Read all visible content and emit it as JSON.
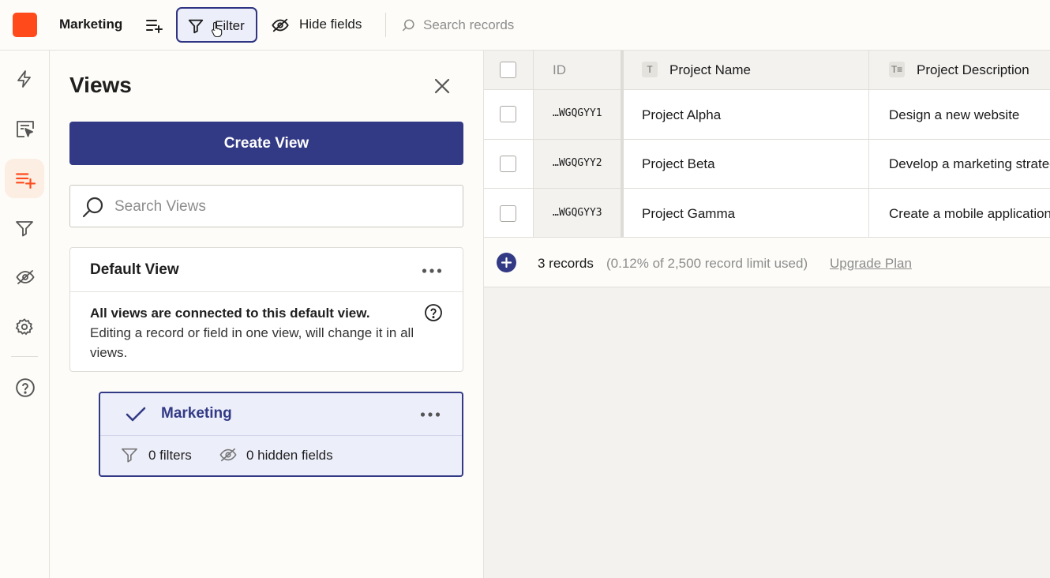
{
  "topbar": {
    "base_name": "Marketing",
    "filter_label": "Filter",
    "hide_fields_label": "Hide fields",
    "search_placeholder": "Search records"
  },
  "views_panel": {
    "title": "Views",
    "create_label": "Create View",
    "search_placeholder": "Search Views",
    "default_view": {
      "name": "Default View",
      "info_bold": "All views are connected to this default view.",
      "info_text": "Editing a record or field in one view, will change it in all views."
    },
    "selected_view": {
      "name": "Marketing",
      "filters_label": "0 filters",
      "hidden_fields_label": "0 hidden fields"
    }
  },
  "grid": {
    "columns": [
      {
        "label": "ID"
      },
      {
        "label": "Project Name",
        "type_icon": "T"
      },
      {
        "label": "Project Description",
        "type_icon": "T≡"
      }
    ],
    "rows": [
      {
        "id": "…WGQGYY1",
        "name": "Project Alpha",
        "description": "Design a new website"
      },
      {
        "id": "…WGQGYY2",
        "name": "Project Beta",
        "description": "Develop a marketing strategy"
      },
      {
        "id": "…WGQGYY3",
        "name": "Project Gamma",
        "description": "Create a mobile application"
      }
    ],
    "footer": {
      "count": "3 records",
      "usage": "(0.12% of 2,500 record limit used)",
      "upgrade": "Upgrade Plan"
    }
  },
  "colors": {
    "brand": "#ff4a1c",
    "primary": "#333a85",
    "active_rail_bg": "#fdeee4"
  },
  "icons": {
    "rail": [
      "lightning-icon",
      "interface-icon",
      "views-icon",
      "filter-icon",
      "hide-icon",
      "settings-icon",
      "help-icon"
    ]
  }
}
